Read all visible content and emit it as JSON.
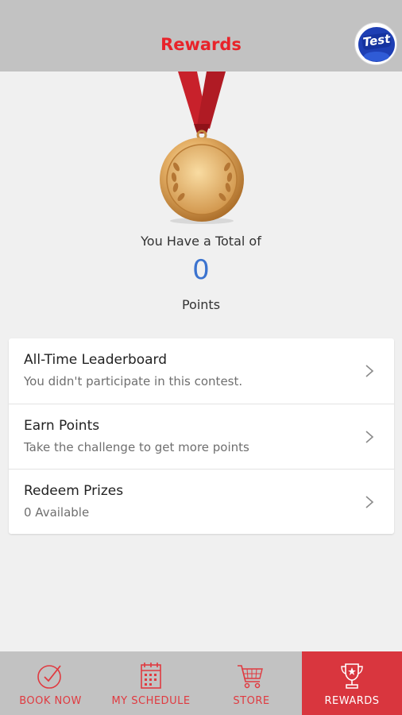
{
  "header": {
    "title": "Rewards",
    "avatar_text": "Test"
  },
  "summary": {
    "total_label": "You Have a Total of",
    "points": "0",
    "points_label": "Points"
  },
  "menu": {
    "items": [
      {
        "title": "All-Time Leaderboard",
        "subtitle": "You didn't participate in this contest."
      },
      {
        "title": "Earn Points",
        "subtitle": "Take the challenge to get more points"
      },
      {
        "title": "Redeem Prizes",
        "subtitle": "0 Available"
      }
    ]
  },
  "tabs": [
    {
      "label": "BOOK NOW",
      "icon": "check-circle-icon"
    },
    {
      "label": "MY SCHEDULE",
      "icon": "calendar-icon"
    },
    {
      "label": "STORE",
      "icon": "cart-icon"
    },
    {
      "label": "REWARDS",
      "icon": "trophy-icon",
      "active": true
    }
  ],
  "colors": {
    "accent": "#e8232a",
    "tab_active": "#d9363e",
    "points": "#3b73cf",
    "bars": "#c2c2c2"
  }
}
